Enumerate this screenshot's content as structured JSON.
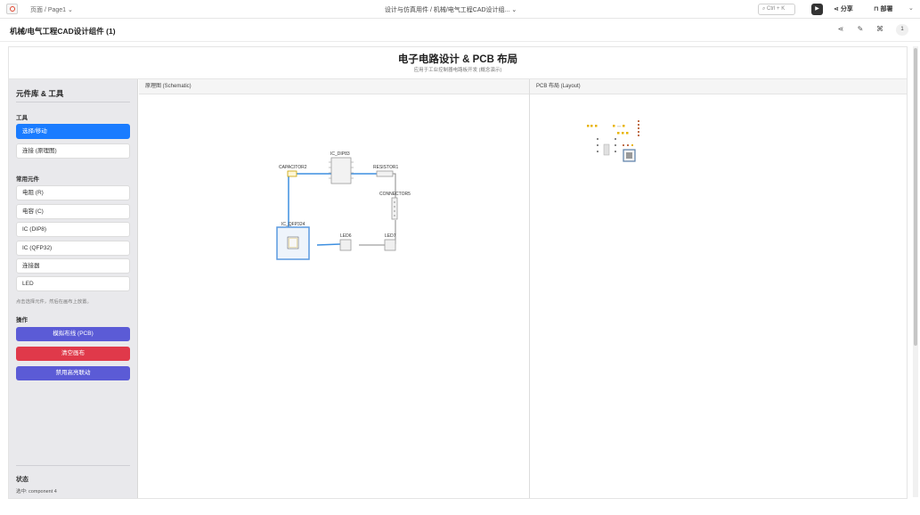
{
  "topbar": {
    "breadcrumb": "页面 / Page1 ⌄",
    "center_crumb": "设计与仿真用件 / 机械/电气工程CAD设计组...  ⌄",
    "search_placeholder": "Ctrl + K",
    "share_label": "分享",
    "deploy_label": "部署"
  },
  "document": {
    "title": "机械/电气工程CAD设计组件 (1)",
    "badge": "1"
  },
  "header": {
    "title": "电子电路设计 & PCB 布局",
    "subtitle": "应用于工业控制器电路板开发 (概念演示)"
  },
  "sidebar": {
    "title": "元件库 & 工具",
    "tools_section": "工具",
    "tools": [
      "选择/移动",
      "连接 (原理图)"
    ],
    "components_section": "常用元件",
    "components": [
      "电阻 (R)",
      "电容 (C)",
      "IC (DIP8)",
      "IC (QFP32)",
      "连接器",
      "LED"
    ],
    "hint": "点击选择元件，然后在画布上放置。",
    "actions_section": "操作",
    "actions": [
      "模拟布线 (PCB)",
      "清空画布",
      "禁用高亮联动"
    ],
    "status_title": "状态",
    "status_text": "选中: component 4"
  },
  "panes": {
    "schematic_label": "原理图 (Schematic)",
    "layout_label": "PCB 布局 (Layout)"
  },
  "schematic": {
    "components": [
      {
        "label": "IC_DIP83",
        "kind": "dip"
      },
      {
        "label": "CAPACITOR2",
        "kind": "cap"
      },
      {
        "label": "RESISTOR1",
        "kind": "res"
      },
      {
        "label": "CONNECTOR5",
        "kind": "conn"
      },
      {
        "label": "IC_QFP324",
        "kind": "qfp"
      },
      {
        "label": "LED6",
        "kind": "led"
      },
      {
        "label": "LED7",
        "kind": "led"
      }
    ]
  },
  "colors": {
    "accent": "#1a7cff",
    "wire_blue": "#3d8fe0",
    "wire_gray": "#8a8a8a",
    "action_indigo": "#5b5bd6",
    "action_red": "#e0394a",
    "pad_gold": "#e8b400"
  }
}
